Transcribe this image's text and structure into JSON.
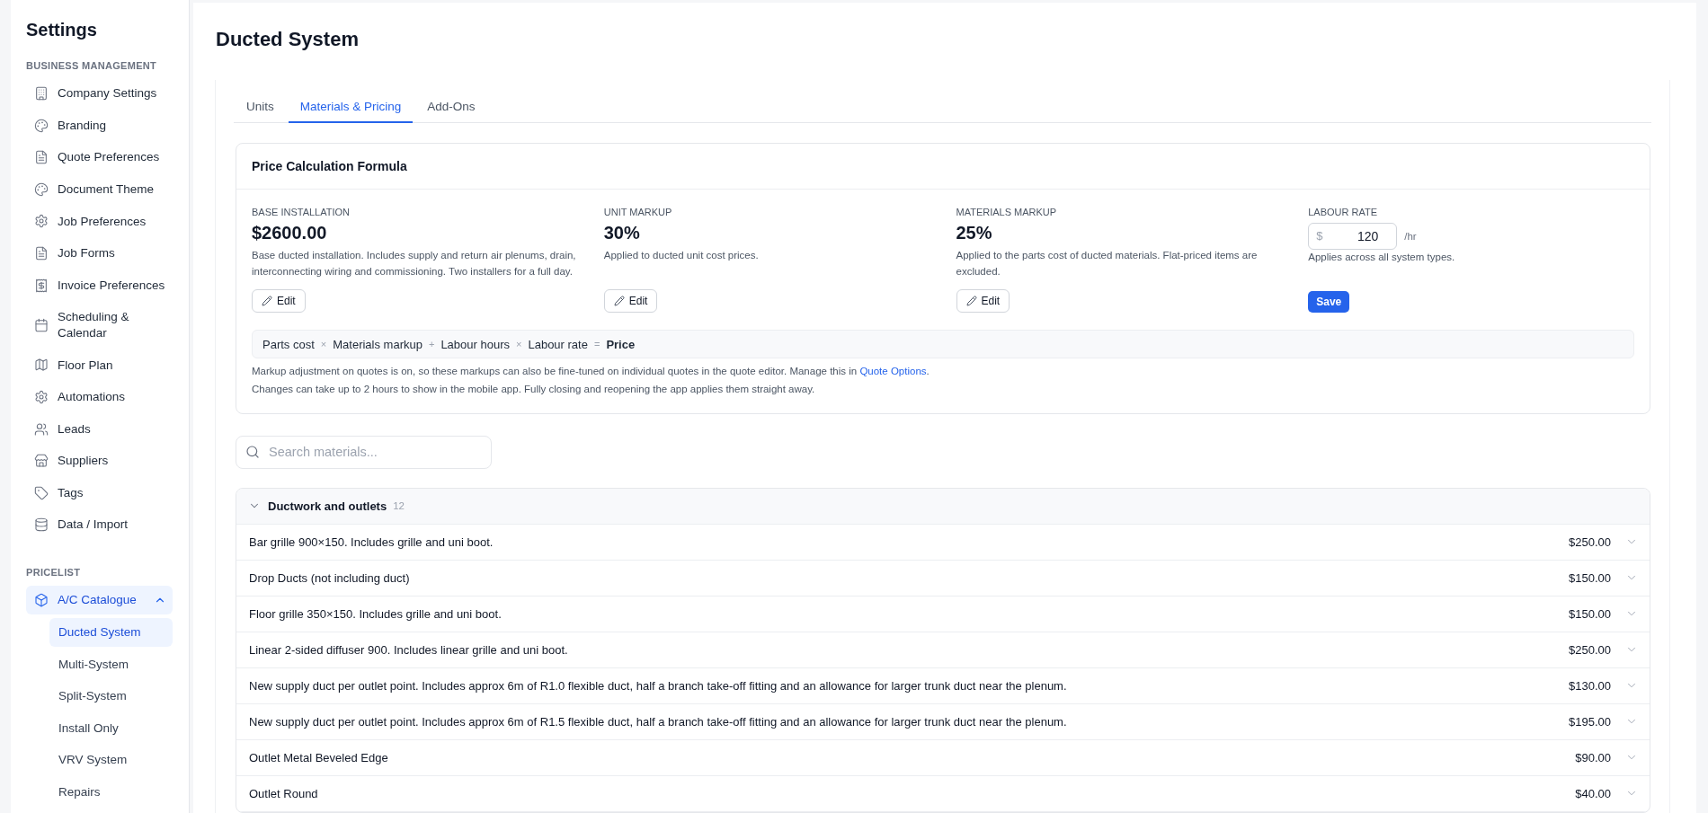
{
  "sidebar": {
    "title": "Settings",
    "sections": [
      {
        "heading": "BUSINESS MANAGEMENT",
        "items": [
          {
            "label": "Company Settings",
            "selected": false
          },
          {
            "label": "Branding",
            "selected": false
          },
          {
            "label": "Quote Preferences",
            "selected": false
          },
          {
            "label": "Document Theme",
            "selected": false
          },
          {
            "label": "Job Preferences",
            "selected": false
          },
          {
            "label": "Job Forms",
            "selected": false
          },
          {
            "label": "Invoice Preferences",
            "selected": false
          },
          {
            "label": "Scheduling & Calendar",
            "selected": false
          },
          {
            "label": "Floor Plan",
            "selected": false
          },
          {
            "label": "Automations",
            "selected": false
          },
          {
            "label": "Leads",
            "selected": false
          },
          {
            "label": "Suppliers",
            "selected": false
          },
          {
            "label": "Tags",
            "selected": false
          },
          {
            "label": "Data / Import",
            "selected": false
          }
        ]
      },
      {
        "heading": "PRICELIST",
        "items": [
          {
            "label": "A/C Catalogue",
            "selected": true,
            "expanded": true,
            "children": [
              {
                "label": "Ducted System",
                "selected": true
              },
              {
                "label": "Multi-System",
                "selected": false
              },
              {
                "label": "Split-System",
                "selected": false
              },
              {
                "label": "Install Only",
                "selected": false
              },
              {
                "label": "VRV System",
                "selected": false
              },
              {
                "label": "Repairs",
                "selected": false
              }
            ]
          }
        ]
      }
    ]
  },
  "page": {
    "title": "Ducted System"
  },
  "tabs": [
    {
      "label": "Units",
      "selected": false
    },
    {
      "label": "Materials & Pricing",
      "selected": true
    },
    {
      "label": "Add-Ons",
      "selected": false
    }
  ],
  "formula_card": {
    "title": "Price Calculation Formula",
    "fields": [
      {
        "kind": "stat",
        "label": "BASE INSTALLATION",
        "value": "$2600.00",
        "description": "Base ducted installation. Includes supply and return air plenums, drain, interconnecting wiring and commissioning. Two installers for a full day.",
        "action": "Edit"
      },
      {
        "kind": "stat",
        "label": "UNIT MARKUP",
        "value": "30%",
        "description": "Applied to ducted unit cost prices.",
        "action": "Edit"
      },
      {
        "kind": "stat",
        "label": "MATERIALS MARKUP",
        "value": "25%",
        "description": "Applied to the parts cost of ducted materials. Flat-priced items are excluded.",
        "action": "Edit"
      },
      {
        "kind": "rate",
        "label": "LABOUR RATE",
        "prefix": "$",
        "value": "120",
        "suffix": "/hr",
        "description": "Applies across all system types.",
        "action": "Save"
      }
    ],
    "formula": [
      {
        "kind": "term",
        "text": "Parts cost"
      },
      {
        "kind": "operator",
        "text": "×"
      },
      {
        "kind": "term",
        "text": "Materials markup"
      },
      {
        "kind": "operator",
        "text": "+"
      },
      {
        "kind": "term",
        "text": "Labour hours"
      },
      {
        "kind": "operator",
        "text": "×"
      },
      {
        "kind": "term",
        "text": "Labour rate"
      },
      {
        "kind": "operator",
        "text": "="
      },
      {
        "kind": "result",
        "text": "Price"
      }
    ],
    "notes": [
      [
        {
          "kind": "text",
          "text": "Markup adjustment on quotes is on, so these markups can also be fine-tuned on individual quotes in the quote editor. Manage this in "
        },
        {
          "kind": "link",
          "text": "Quote Options"
        },
        {
          "kind": "text",
          "text": "."
        }
      ],
      [
        {
          "kind": "text",
          "text": "Changes can take up to 2 hours to show in the mobile app. Fully closing and reopening the app applies them straight away."
        }
      ]
    ]
  },
  "search": {
    "placeholder": "Search materials..."
  },
  "groups": [
    {
      "name": "Ductwork and outlets",
      "count": "12",
      "expanded": true,
      "items": [
        {
          "name": "Bar grille 900×150. Includes grille and uni boot.",
          "price": "$250.00"
        },
        {
          "name": "Drop Ducts (not including duct)",
          "price": "$150.00"
        },
        {
          "name": "Floor grille 350×150. Includes grille and uni boot.",
          "price": "$150.00"
        },
        {
          "name": "Linear 2-sided diffuser 900. Includes linear grille and uni boot.",
          "price": "$250.00"
        },
        {
          "name": "New supply duct per outlet point. Includes approx 6m of R1.0 flexible duct, half a branch take-off fitting and an allowance for larger trunk duct near the plenum.",
          "price": "$130.00"
        },
        {
          "name": "New supply duct per outlet point. Includes approx 6m of R1.5 flexible duct, half a branch take-off fitting and an allowance for larger trunk duct near the plenum.",
          "price": "$195.00"
        },
        {
          "name": "Outlet Metal Beveled Edge",
          "price": "$90.00"
        },
        {
          "name": "Outlet Round",
          "price": "$40.00"
        }
      ]
    }
  ]
}
